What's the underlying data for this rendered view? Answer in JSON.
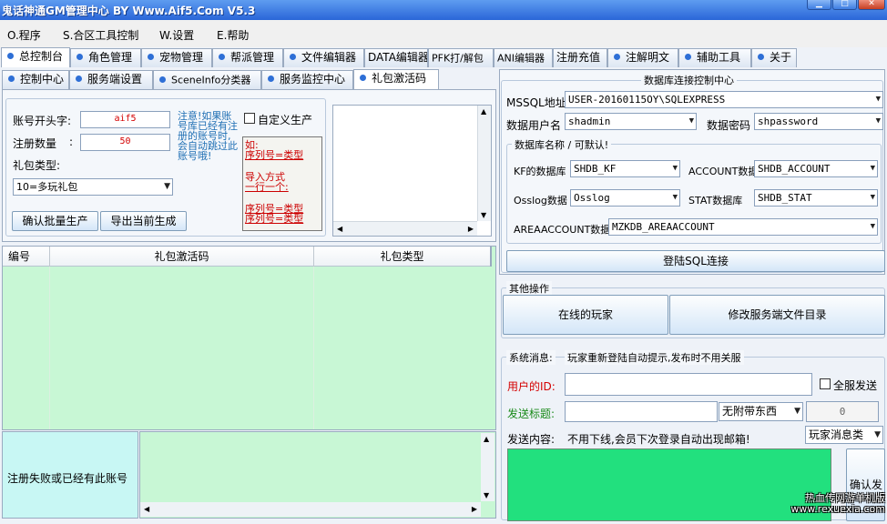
{
  "window": {
    "title": "鬼话神通GM管理中心 BY Www.Aif5.Com  V5.3"
  },
  "menu": [
    {
      "label": "O.程序"
    },
    {
      "label": "S.合区工具控制"
    },
    {
      "label": "W.设置"
    },
    {
      "label": "E.帮助"
    }
  ],
  "main_tabs": [
    {
      "label": "总控制台"
    },
    {
      "label": "角色管理"
    },
    {
      "label": "宠物管理"
    },
    {
      "label": "帮派管理"
    },
    {
      "label": "文件编辑器"
    },
    {
      "label": "DATA编辑器"
    },
    {
      "label": "PFK打/解包"
    },
    {
      "label": "ANI编辑器"
    },
    {
      "label": "注册充值"
    },
    {
      "label": "注解明文"
    },
    {
      "label": "辅助工具"
    },
    {
      "label": "关于"
    }
  ],
  "sub_tabs": [
    {
      "label": "控制中心"
    },
    {
      "label": "服务端设置"
    },
    {
      "label": "SceneInfo分类器"
    },
    {
      "label": "服务监控中心"
    },
    {
      "label": "礼包激活码"
    }
  ],
  "gift": {
    "prefix_label": "账号开头字:",
    "prefix_value": "aif5",
    "count_label": "注册数量",
    "count_colon": ":",
    "count_value": "50",
    "type_label": "礼包类型:",
    "type_value": "10=多玩礼包",
    "note": "注意!如果账号库已经有注册的账号时,会自动跳过此账号哦!",
    "custom_label": "自定义生产",
    "hint_1": "如:",
    "hint_2": "序列号=类型",
    "hint_3": "导入方式",
    "hint_4": "一行一个:",
    "hint_5": "序列号=类型",
    "hint_6": "序列号=类型",
    "confirm_button": "确认批量生产",
    "export_button": "导出当前生成"
  },
  "grid": {
    "columns": [
      "编号",
      "礼包激活码",
      "礼包类型"
    ]
  },
  "footer": {
    "status": "注册失败或已经有此账号"
  },
  "db": {
    "title": "数据库连接控制中心",
    "mssql_label": "MSSQL地址:",
    "mssql_value": "USER-20160115OY\\SQLEXPRESS",
    "user_label": "数据用户名",
    "user_value": "shadmin",
    "pwd_label": "数据密码",
    "pwd_value": "shpassword",
    "group_legend": "数据库名称 / 可默认!",
    "kf_label": "KF的数据库",
    "kf_value": "SHDB_KF",
    "account_label": "ACCOUNT数据",
    "account_value": "SHDB_ACCOUNT",
    "osslog_label": "Osslog数据",
    "osslog_value": "Osslog",
    "stat_label": "STAT数据库",
    "stat_value": "SHDB_STAT",
    "area_label": "AREAACCOUNT数据库",
    "area_value": "MZKDB_AREAACCOUNT",
    "login_button": "登陆SQL连接"
  },
  "other": {
    "legend": "其他操作",
    "online_button": "在线的玩家",
    "modify_button": "修改服务端文件目录"
  },
  "sysmsg": {
    "legend": "系统消息:",
    "legend_note": "玩家重新登陆自动提示,发布时不用关服",
    "userid_label": "用户的ID:",
    "all_label": "全服发送",
    "send_title_label": "发送标题:",
    "attach_value": "无附带东西",
    "qty_value": "0",
    "content_label": "发送内容:",
    "content_note": "不用下线,会员下次登录自动出现邮箱!",
    "msg_type_value": "玩家消息类",
    "confirm_button": "确认发",
    "watermark": "热血传网游单机版 www.rexuexia.com"
  },
  "colors": {
    "titlebar": "#2a66d8",
    "grid_bg": "#c8f7d5",
    "note_text": "#1f6fb4",
    "hint_text": "#cc0000",
    "prefix_text": "#d40000",
    "content_bg": "#22e07e",
    "userid_label": "#d40000",
    "title_label": "#1a8a1a"
  }
}
